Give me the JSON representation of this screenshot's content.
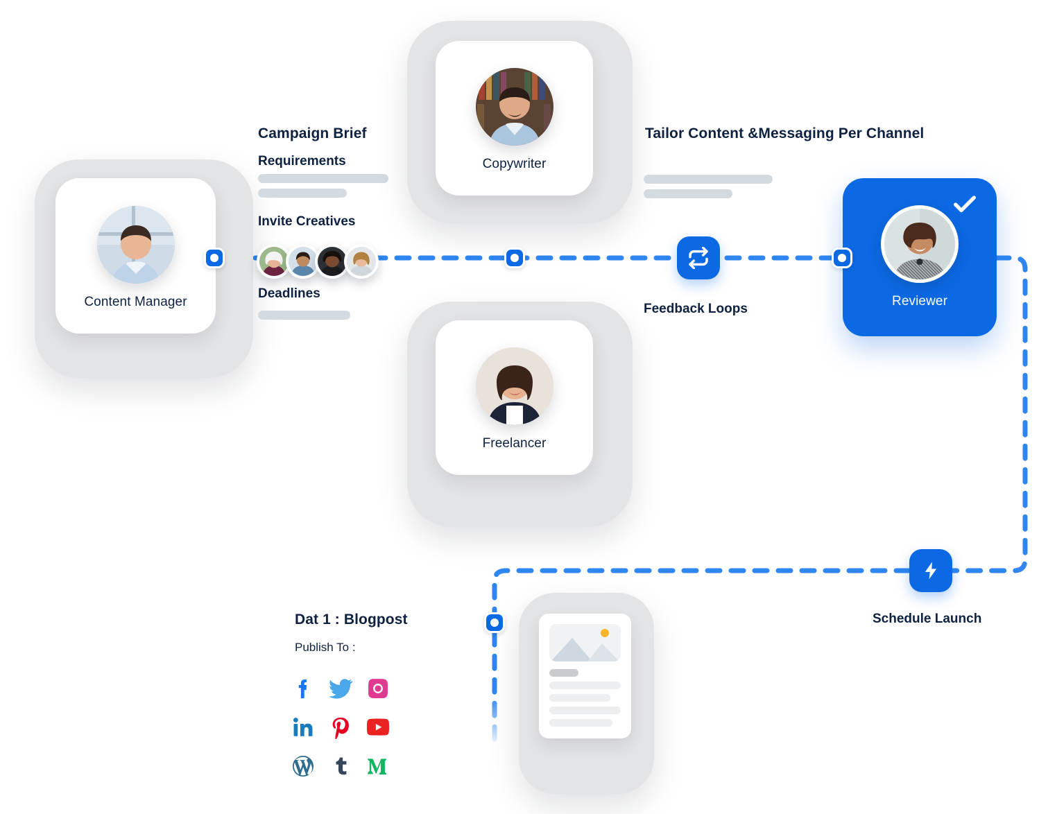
{
  "accent": "#0c69e4",
  "text_color": "#0e2141",
  "bar_color": "#d3dbe1",
  "shell_color": "#e3e4e6",
  "roles": {
    "content_manager": "Content Manager",
    "copywriter": "Copywriter",
    "freelancer": "Freelancer",
    "reviewer": "Reviewer"
  },
  "brief": {
    "title": "Campaign Brief",
    "requirements_label": "Requirements",
    "invite_label": "Invite Creatives",
    "deadlines_label": "Deadlines"
  },
  "channel": {
    "title": "Tailor Content &Messaging Per Channel"
  },
  "steps": {
    "feedback_label": "Feedback Loops",
    "feedback_icon": "repeat-icon",
    "schedule_label": "Schedule Launch",
    "schedule_icon": "bolt-icon"
  },
  "publish": {
    "title": "Dat 1 : Blogpost",
    "subtitle": "Publish To :",
    "networks": [
      {
        "name": "facebook-icon",
        "color": "#1778f2"
      },
      {
        "name": "twitter-icon",
        "color": "#4aa8ea"
      },
      {
        "name": "instagram-icon",
        "color": "#e03a90"
      },
      {
        "name": "linkedin-icon",
        "color": "#1c7bbd"
      },
      {
        "name": "pinterest-icon",
        "color": "#e60023"
      },
      {
        "name": "youtube-icon",
        "color": "#ea2322"
      },
      {
        "name": "wordpress-icon",
        "color": "#2e6d8e"
      },
      {
        "name": "tumblr-icon",
        "color": "#36465d"
      },
      {
        "name": "medium-icon",
        "color": "#12b561"
      }
    ]
  },
  "badges": {
    "approved_icon": "check-icon"
  },
  "nodes": {
    "content_manager_out": "connector-node",
    "copywriter_out": "connector-node",
    "reviewer_in": "connector-node",
    "document_in": "connector-node"
  }
}
